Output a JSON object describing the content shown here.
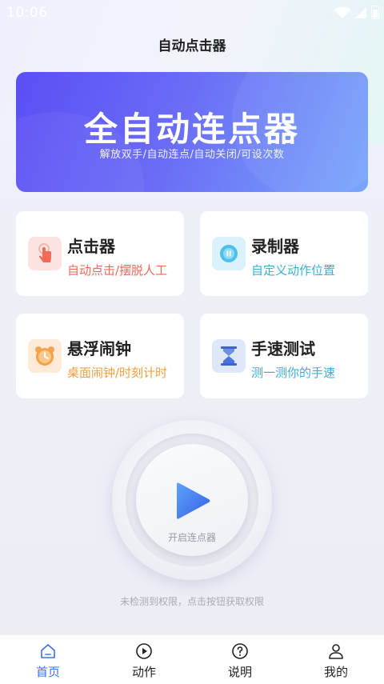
{
  "status_bar": {
    "time": "10:06",
    "icons": [
      "wifi-icon",
      "signal-icon",
      "battery-icon"
    ]
  },
  "header": {
    "title": "自动点击器"
  },
  "banner": {
    "title": "全自动连点器",
    "subtitle": "解放双手/自动连点/自动关闭/可设次数"
  },
  "features": [
    {
      "title": "点击器",
      "subtitle": "自动点击/摆脱人工",
      "icon": "tap-hand-icon",
      "accent": "#f06a5a"
    },
    {
      "title": "录制器",
      "subtitle": "自定义动作位置",
      "icon": "record-icon",
      "accent": "#3ab0d6"
    },
    {
      "title": "悬浮闹钟",
      "subtitle": "桌面闹钟/时刻计时",
      "icon": "alarm-clock-icon",
      "accent": "#f0a040"
    },
    {
      "title": "手速测试",
      "subtitle": "测一测你的手速",
      "icon": "hourglass-icon",
      "accent": "#3ab0d6"
    }
  ],
  "start": {
    "label": "开启连点器",
    "hint": "未检测到权限，点击按钮获取权限"
  },
  "tabs": [
    {
      "label": "首页",
      "icon": "home-icon",
      "active": true
    },
    {
      "label": "动作",
      "icon": "play-circle-icon",
      "active": false
    },
    {
      "label": "说明",
      "icon": "help-icon",
      "active": false
    },
    {
      "label": "我的",
      "icon": "user-icon",
      "active": false
    }
  ],
  "colors": {
    "accent": "#3f6ff0",
    "banner_start": "#5b4ef5",
    "banner_end": "#78a6fb"
  }
}
